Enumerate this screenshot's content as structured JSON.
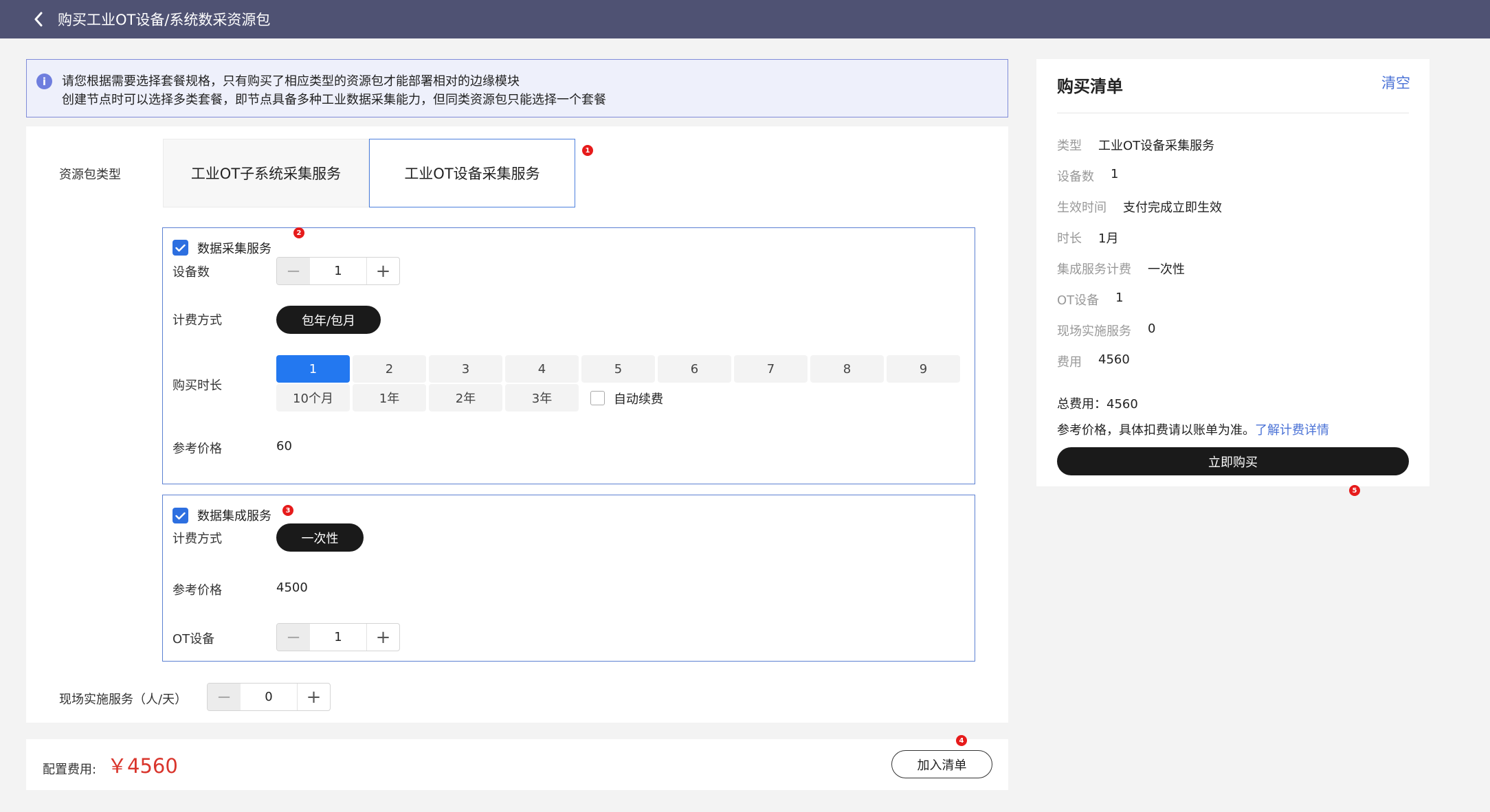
{
  "header": {
    "title": "购买工业OT设备/系统数采资源包"
  },
  "notice": {
    "line1": "请您根据需要选择套餐规格，只有购买了相应类型的资源包才能部署相对的边缘模块",
    "line2": "创建节点时可以选择多类套餐，即节点具备多种工业数据采集能力，但同类资源包只能选择一个套餐"
  },
  "package_type": {
    "label": "资源包类型",
    "tabs": [
      {
        "label": "工业OT子系统采集服务",
        "selected": false
      },
      {
        "label": "工业OT设备采集服务",
        "selected": true
      }
    ]
  },
  "badges": [
    "1",
    "2",
    "3",
    "4",
    "5"
  ],
  "data_collection": {
    "title": "数据采集服务",
    "checked": true,
    "device_count_label": "设备数",
    "device_count": "1",
    "billing_label": "计费方式",
    "billing_value": "包年/包月",
    "duration_label": "购买时长",
    "durations": [
      "1",
      "2",
      "3",
      "4",
      "5",
      "6",
      "7",
      "8",
      "9",
      "10个月",
      "1年",
      "2年",
      "3年"
    ],
    "selected_duration": "1",
    "auto_renew_label": "自动续费",
    "auto_renew": false,
    "price_label": "参考价格",
    "price": "60"
  },
  "data_integration": {
    "title": "数据集成服务",
    "checked": true,
    "billing_label": "计费方式",
    "billing_value": "一次性",
    "price_label": "参考价格",
    "price": "4500",
    "ot_device_label": "OT设备",
    "ot_device_count": "1"
  },
  "onsite": {
    "label": "现场实施服务（人/天）",
    "value": "0"
  },
  "stepper_glyphs": {
    "minus": "−",
    "plus": "+"
  },
  "footer": {
    "fee_label": "配置费用:",
    "fee_value": "￥4560",
    "add_button": "加入清单"
  },
  "cart": {
    "title": "购买清单",
    "clear": "清空",
    "rows": [
      {
        "key": "类型",
        "value": "工业OT设备采集服务"
      },
      {
        "key": "设备数",
        "value": "1"
      },
      {
        "key": "生效时间",
        "value": "支付完成立即生效"
      },
      {
        "key": "时长",
        "value": "1月"
      },
      {
        "key": "集成服务计费",
        "value": "一次性"
      },
      {
        "key": "OT设备",
        "value": "1"
      },
      {
        "key": "现场实施服务",
        "value": "0"
      },
      {
        "key": "费用",
        "value": "4560"
      }
    ],
    "total": "总费用：4560",
    "note": "参考价格，具体扣费请以账单为准。",
    "note_link": "了解计费详情",
    "buy_button": "立即购买"
  },
  "colors": {
    "topbar": "#4f5273",
    "primary_blue": "#2378f0",
    "panel_border": "#5b80d2",
    "price_red": "#d9352c",
    "badge_red": "#e61b1b",
    "link_blue": "#4a72d6"
  }
}
